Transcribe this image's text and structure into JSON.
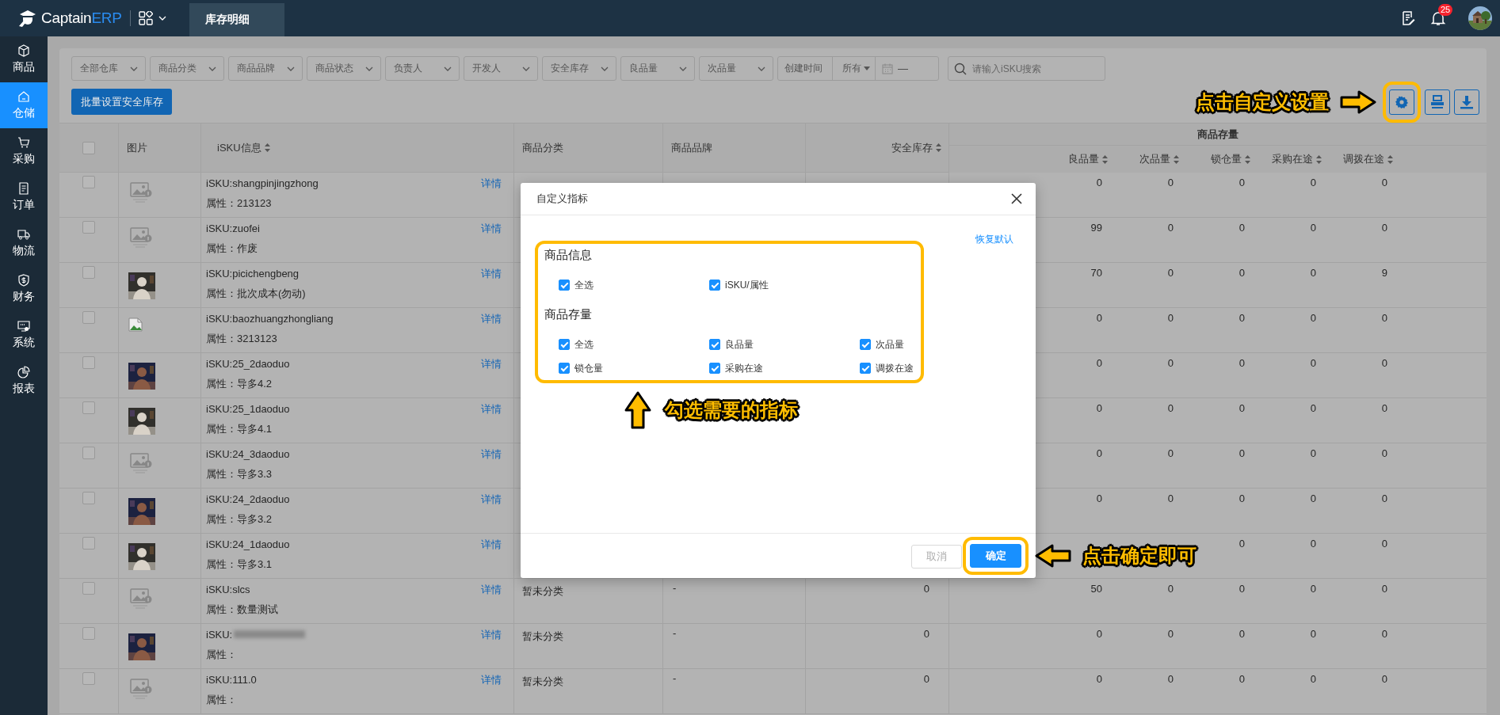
{
  "topbar": {
    "brand": {
      "text": "Captain",
      "accent": "ERP"
    },
    "tabs": [
      {
        "label": "库存明细",
        "selected": true
      }
    ],
    "notification_count": "25"
  },
  "sidebar": {
    "items": [
      {
        "label": "商品",
        "selected": false
      },
      {
        "label": "仓储",
        "selected": true
      },
      {
        "label": "采购",
        "selected": false
      },
      {
        "label": "订单",
        "selected": false
      },
      {
        "label": "物流",
        "selected": false
      },
      {
        "label": "财务",
        "selected": false
      },
      {
        "label": "系统",
        "selected": false
      },
      {
        "label": "报表",
        "selected": false
      }
    ]
  },
  "filters": [
    {
      "placeholder": "全部仓库"
    },
    {
      "placeholder": "商品分类"
    },
    {
      "placeholder": "商品品牌"
    },
    {
      "placeholder": "商品状态"
    },
    {
      "placeholder": "负责人"
    },
    {
      "placeholder": "开发人"
    },
    {
      "placeholder": "安全库存"
    },
    {
      "placeholder": "良品量"
    },
    {
      "placeholder": "次品量"
    }
  ],
  "date_filter": {
    "label": "创建时间",
    "range": "所有",
    "separator": "—"
  },
  "search": {
    "placeholder": "请输入iSKU搜索"
  },
  "batch_button": "批量设置安全库存",
  "table": {
    "select_all": {
      "checked": false
    },
    "columns": [
      {
        "label": "图片",
        "sortable": false
      },
      {
        "label": "iSKU信息",
        "sortable": true
      },
      {
        "label": "商品分类",
        "sortable": false
      },
      {
        "label": "商品品牌",
        "sortable": false
      },
      {
        "label": "安全库存",
        "sortable": true
      }
    ],
    "group": {
      "label": "商品存量",
      "columns": [
        {
          "label": "良品量",
          "sortable": true
        },
        {
          "label": "次品量",
          "sortable": true
        },
        {
          "label": "锁仓量",
          "sortable": true
        },
        {
          "label": "采购在途",
          "sortable": true
        },
        {
          "label": "调拨在途",
          "sortable": true
        }
      ]
    },
    "rows": [
      {
        "checked": false,
        "thumbnail": {
          "kind": "placeholder"
        },
        "sku": "iSKU:shangpinjingzhong",
        "attr": "属性：213123",
        "detail": "详情",
        "stock": {
          "good": "0",
          "defective": "0",
          "locked": "0",
          "purchasing": "0",
          "transfer": "0"
        }
      },
      {
        "checked": false,
        "thumbnail": {
          "kind": "placeholder"
        },
        "sku": "iSKU:zuofei",
        "attr": "属性：作废",
        "detail": "详情",
        "stock": {
          "good": "99",
          "defective": "0",
          "locked": "0",
          "purchasing": "0",
          "transfer": "0"
        }
      },
      {
        "checked": false,
        "sku": "iSKU:picichengbeng",
        "attr": "属性：批次成本(勿动)",
        "detail": "详情",
        "stock": {
          "good": "70",
          "defective": "0",
          "locked": "0",
          "purchasing": "0",
          "transfer": "9"
        }
      },
      {
        "checked": false,
        "thumbnail": {
          "kind": "broken"
        },
        "sku": "iSKU:baozhuangzhongliang",
        "attr": "属性：3213123",
        "detail": "详情",
        "stock": {
          "good": "0",
          "defective": "0",
          "locked": "0",
          "purchasing": "0",
          "transfer": "0"
        }
      },
      {
        "checked": false,
        "sku": "iSKU:25_2daoduo",
        "attr": "属性：导多4.2",
        "detail": "详情",
        "stock": {
          "good": "0",
          "defective": "0",
          "locked": "0",
          "purchasing": "0",
          "transfer": "0"
        }
      },
      {
        "checked": false,
        "sku": "iSKU:25_1daoduo",
        "attr": "属性：导多4.1",
        "detail": "详情",
        "stock": {
          "good": "0",
          "defective": "0",
          "locked": "0",
          "purchasing": "0",
          "transfer": "0"
        }
      },
      {
        "checked": false,
        "thumbnail": {
          "kind": "placeholder"
        },
        "sku": "iSKU:24_3daoduo",
        "attr": "属性：导多3.3",
        "detail": "详情",
        "stock": {
          "good": "0",
          "defective": "0",
          "locked": "0",
          "purchasing": "0",
          "transfer": "0"
        }
      },
      {
        "checked": false,
        "sku": "iSKU:24_2daoduo",
        "attr": "属性：导多3.2",
        "detail": "详情",
        "stock": {
          "good": "0",
          "defective": "0",
          "locked": "0",
          "purchasing": "0",
          "transfer": "0"
        }
      },
      {
        "checked": false,
        "sku": "iSKU:24_1daoduo",
        "attr": "属性：导多3.1",
        "detail": "详情",
        "stock": {
          "locked": "0",
          "purchasing": "0",
          "transfer": "0"
        }
      },
      {
        "checked": false,
        "thumbnail": {
          "kind": "placeholder"
        },
        "sku": "iSKU:slcs",
        "attr": "属性：数量测试",
        "detail": "详情",
        "category": "暂未分类",
        "brand": "-",
        "safety": "0",
        "stock": {
          "good": "50",
          "defective": "0",
          "locked": "0",
          "purchasing": "0",
          "transfer": "0"
        }
      },
      {
        "checked": false,
        "sku": "iSKU:",
        "redacted": true,
        "attr": "属性：",
        "detail": "详情",
        "category": "暂未分类",
        "brand": "-",
        "safety": "0",
        "stock": {
          "good": "0",
          "defective": "0",
          "locked": "0",
          "purchasing": "0",
          "transfer": "0"
        }
      },
      {
        "checked": false,
        "thumbnail": {
          "kind": "placeholder"
        },
        "sku": "iSKU:111.0",
        "attr": "属性：",
        "detail": "详情",
        "category": "暂未分类",
        "brand": "-",
        "safety": "0",
        "stock": {
          "good": "0",
          "defective": "0",
          "locked": "0",
          "purchasing": "0",
          "transfer": "0"
        }
      }
    ]
  },
  "modal": {
    "title": "自定义指标",
    "reset": "恢复默认",
    "sections": [
      {
        "title": "商品信息",
        "options": [
          {
            "label": "全选",
            "checked": true
          },
          {
            "label": "iSKU/属性",
            "checked": true
          }
        ]
      },
      {
        "title": "商品存量",
        "options": [
          {
            "label": "全选",
            "checked": true
          },
          {
            "label": "良品量",
            "checked": true
          },
          {
            "label": "次品量",
            "checked": true
          },
          {
            "label": "锁仓量",
            "checked": true
          },
          {
            "label": "采购在途",
            "checked": true
          },
          {
            "label": "调拨在途",
            "checked": true
          }
        ]
      }
    ],
    "buttons": [
      {
        "label": "取消",
        "kind": "default"
      },
      {
        "label": "确定",
        "kind": "primary"
      }
    ]
  },
  "annotations": [
    {
      "text": "点击自定义设置",
      "arrow": {
        "kind": "right"
      }
    },
    {
      "text": "勾选需要的指标",
      "arrow": {
        "kind": "up"
      }
    },
    {
      "text": "点击确定即可",
      "arrow": {
        "kind": "left"
      }
    }
  ]
}
